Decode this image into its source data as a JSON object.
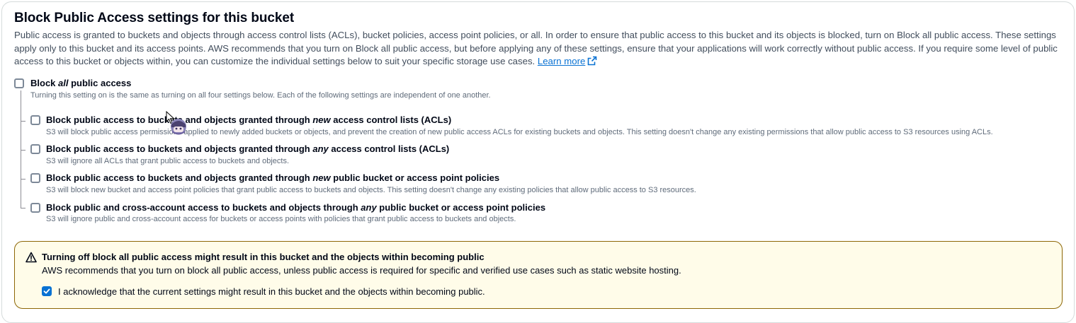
{
  "section": {
    "title": "Block Public Access settings for this bucket",
    "description": "Public access is granted to buckets and objects through access control lists (ACLs), bucket policies, access point policies, or all. In order to ensure that public access to this bucket and its objects is blocked, turn on Block all public access. These settings apply only to this bucket and its access points. AWS recommends that you turn on Block all public access, but before applying any of these settings, ensure that your applications will work correctly without public access. If you require some level of public access to this bucket or objects within, you can customize the individual settings below to suit your specific storage use cases.",
    "learn_more": "Learn more",
    "learn_more_icon": "external-link-icon"
  },
  "block_all": {
    "label_pre": "Block ",
    "label_em": "all",
    "label_post": " public access",
    "description": "Turning this setting on is the same as turning on all four settings below. Each of the following settings are independent of one another.",
    "checked": false
  },
  "options": [
    {
      "label_pre": "Block public access to buckets and objects granted through ",
      "label_em": "new",
      "label_post": " access control lists (ACLs)",
      "description": "S3 will block public access permissions applied to newly added buckets or objects, and prevent the creation of new public access ACLs for existing buckets and objects. This setting doesn't change any existing permissions that allow public access to S3 resources using ACLs.",
      "checked": false
    },
    {
      "label_pre": "Block public access to buckets and objects granted through ",
      "label_em": "any",
      "label_post": " access control lists (ACLs)",
      "description": "S3 will ignore all ACLs that grant public access to buckets and objects.",
      "checked": false
    },
    {
      "label_pre": "Block public access to buckets and objects granted through ",
      "label_em": "new",
      "label_post": " public bucket or access point policies",
      "description": "S3 will block new bucket and access point policies that grant public access to buckets and objects. This setting doesn't change any existing policies that allow public access to S3 resources.",
      "checked": false
    },
    {
      "label_pre": "Block public and cross-account access to buckets and objects through ",
      "label_em": "any",
      "label_post": " public bucket or access point policies",
      "description": "S3 will ignore public and cross-account access for buckets or access points with policies that grant public access to buckets and objects.",
      "checked": false
    }
  ],
  "warning": {
    "icon": "warning-icon",
    "title": "Turning off block all public access might result in this bucket and the objects within becoming public",
    "body": "AWS recommends that you turn on block all public access, unless public access is required for specific and verified use cases such as static website hosting.",
    "acknowledge_label": "I acknowledge that the current settings might result in this bucket and the objects within becoming public.",
    "acknowledge_checked": true
  },
  "colors": {
    "link": "#0972d3",
    "warning_border": "#8d6605",
    "warning_bg": "#fffce9",
    "checkbox_checked": "#0972d3"
  }
}
